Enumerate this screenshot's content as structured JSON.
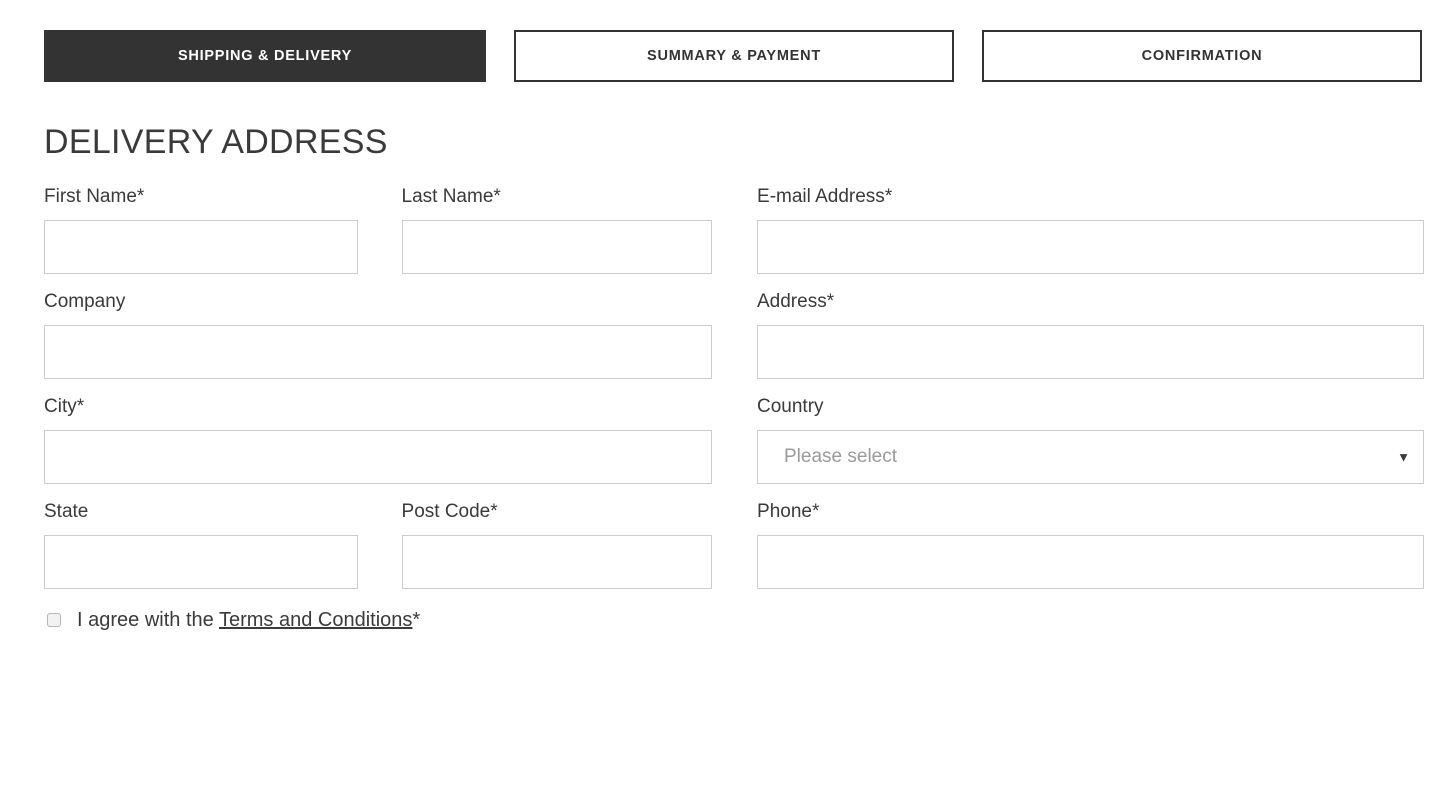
{
  "steps": [
    {
      "label": "SHIPPING & DELIVERY",
      "active": true
    },
    {
      "label": "SUMMARY & PAYMENT",
      "active": false
    },
    {
      "label": "CONFIRMATION",
      "active": false
    }
  ],
  "section": {
    "heading": "DELIVERY ADDRESS"
  },
  "fields": {
    "first_name": {
      "label": "First Name",
      "required": "*",
      "value": ""
    },
    "last_name": {
      "label": "Last Name",
      "required": "*",
      "value": ""
    },
    "email": {
      "label": "E-mail Address",
      "required": "*",
      "value": ""
    },
    "company": {
      "label": "Company",
      "required": "",
      "value": ""
    },
    "address": {
      "label": "Address",
      "required": "*",
      "value": ""
    },
    "city": {
      "label": "City",
      "required": "*",
      "value": ""
    },
    "country": {
      "label": "Country",
      "required": "",
      "selected": "Please select",
      "caret": "▼"
    },
    "state": {
      "label": "State",
      "required": "",
      "value": ""
    },
    "post_code": {
      "label": "Post Code",
      "required": "*",
      "value": ""
    },
    "phone": {
      "label": "Phone",
      "required": "*",
      "value": ""
    }
  },
  "terms": {
    "prefix": "I agree with the ",
    "link_label": "Terms and Conditions",
    "required": "*",
    "checked": false
  },
  "colors": {
    "active_tab_bg": "#333333",
    "tab_border": "#333333",
    "text": "#3a3a3a",
    "input_border": "#cccccc",
    "placeholder": "#9a9a9a"
  }
}
